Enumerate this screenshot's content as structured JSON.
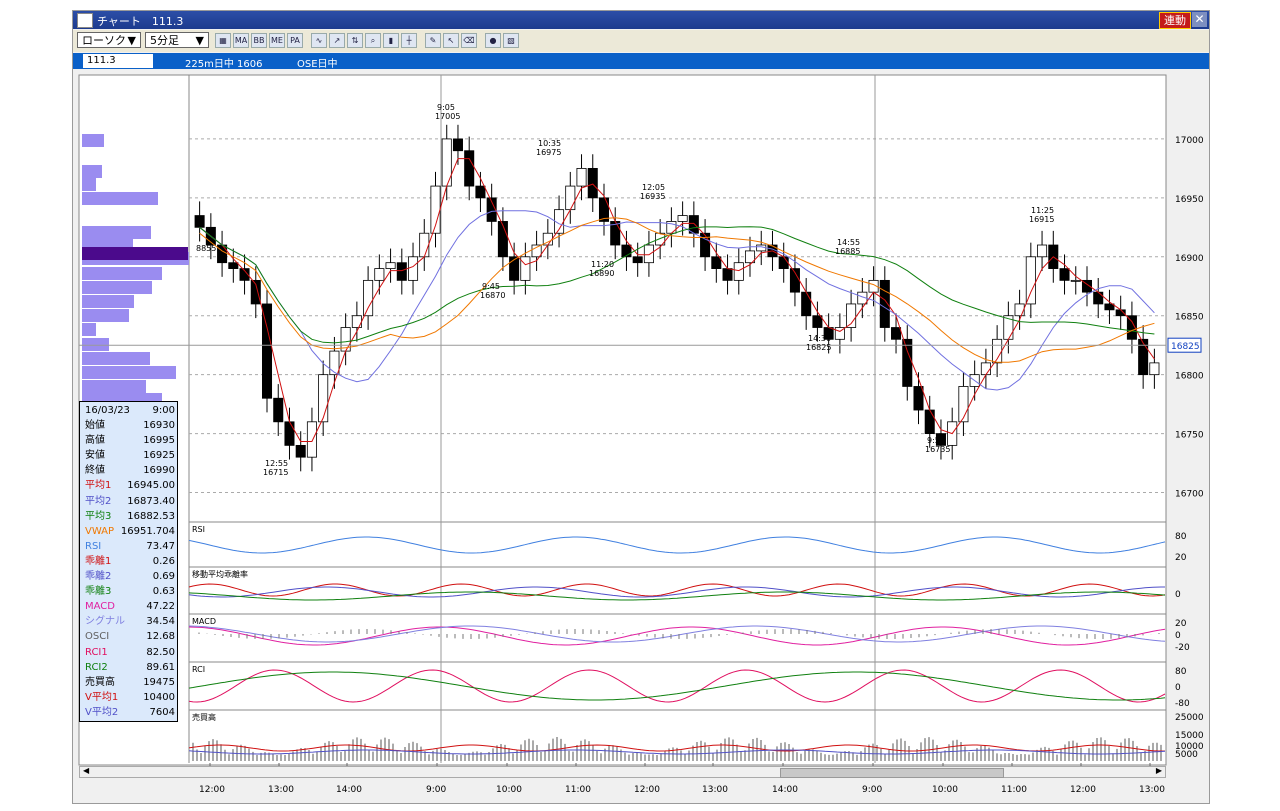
{
  "window": {
    "title": "チャート　111.3",
    "sync_label": "連動",
    "close_label": "✕"
  },
  "toolbar": {
    "chart_type": "ローソク",
    "interval": "5分足",
    "buttons": [
      "map-icon",
      "ma-icon",
      "bb-icon",
      "me-icon",
      "pa-icon",
      "line-icon",
      "trend-icon",
      "scale-icon",
      "zoom-icon",
      "candle-icon",
      "cross-icon",
      "pen-icon",
      "cursor-icon",
      "eraser-icon",
      "bulb-icon",
      "grid-icon"
    ]
  },
  "infobar": {
    "symbol": "111.3",
    "contract": "225m日中 1606",
    "exchange": "OSE日中"
  },
  "price_axis": {
    "ticks": [
      "17000",
      "16950",
      "16900",
      "16850",
      "16800",
      "16750",
      "16700"
    ],
    "current": "16825"
  },
  "annotations": [
    {
      "time": "9:05",
      "price": "17005"
    },
    {
      "time": "10:35",
      "price": "16975"
    },
    {
      "time": "12:05",
      "price": "16935"
    },
    {
      "time": "11:20",
      "price": "16890"
    },
    {
      "time": "9:45",
      "price": "16870"
    },
    {
      "time": "14:55",
      "price": "16885"
    },
    {
      "time": "14:30",
      "price": "16825"
    },
    {
      "time": "12:55",
      "price": "16715"
    },
    {
      "time": "9:55",
      "price": "16735"
    },
    {
      "time": "11:25",
      "price": "16915"
    }
  ],
  "volume_profile_label": "88551",
  "panels": {
    "rsi": {
      "label": "RSI",
      "ticks": [
        "80",
        "20"
      ]
    },
    "deviation": {
      "label": "移動平均乖離率",
      "ticks": [
        "0"
      ]
    },
    "macd": {
      "label": "MACD",
      "ticks": [
        "20",
        "0",
        "-20"
      ]
    },
    "rci": {
      "label": "RCI",
      "ticks": [
        "80",
        "0",
        "-80"
      ]
    },
    "volume": {
      "label": "売買高",
      "ticks": [
        "25000",
        "15000",
        "10000",
        "5000"
      ]
    }
  },
  "time_axis": [
    "12:00",
    "13:00",
    "14:00",
    "9:00",
    "10:00",
    "11:00",
    "12:00",
    "13:00",
    "14:00",
    "9:00",
    "10:00",
    "11:00",
    "12:00",
    "13:00"
  ],
  "info": {
    "date": "16/03/23",
    "time": "9:00",
    "rows": [
      {
        "k": "始値",
        "v": "16930",
        "c": "#000000"
      },
      {
        "k": "高値",
        "v": "16995",
        "c": "#000000"
      },
      {
        "k": "安値",
        "v": "16925",
        "c": "#000000"
      },
      {
        "k": "終値",
        "v": "16990",
        "c": "#000000"
      },
      {
        "k": "平均1",
        "v": "16945.00",
        "c": "#d01010"
      },
      {
        "k": "平均2",
        "v": "16873.40",
        "c": "#5050c8"
      },
      {
        "k": "平均3",
        "v": "16882.53",
        "c": "#108010"
      },
      {
        "k": "VWAP",
        "v": "16951.704",
        "c": "#f07800"
      },
      {
        "k": "RSI",
        "v": "73.47",
        "c": "#4080e0"
      },
      {
        "k": "乖離1",
        "v": "0.26",
        "c": "#d01010"
      },
      {
        "k": "乖離2",
        "v": "0.69",
        "c": "#5050c8"
      },
      {
        "k": "乖離3",
        "v": "0.63",
        "c": "#108010"
      },
      {
        "k": "MACD",
        "v": "47.22",
        "c": "#e020a0"
      },
      {
        "k": "シグナル",
        "v": "34.54",
        "c": "#8080e0"
      },
      {
        "k": "OSCI",
        "v": "12.68",
        "c": "#606060"
      },
      {
        "k": "RCI1",
        "v": "82.50",
        "c": "#e01060"
      },
      {
        "k": "RCI2",
        "v": "89.61",
        "c": "#108010"
      },
      {
        "k": "売買高",
        "v": "19475",
        "c": "#000000"
      },
      {
        "k": "V平均1",
        "v": "10400",
        "c": "#d01010"
      },
      {
        "k": "V平均2",
        "v": "7604",
        "c": "#5050c8"
      }
    ]
  },
  "colors": {
    "titlebar": "#1c3a8e",
    "infobar": "#0a60c8",
    "ma1": "#d01010",
    "ma2": "#7070e0",
    "ma3": "#108010",
    "vwap": "#f07800",
    "profile": "#9a8cf0",
    "profile_hi": "#4b0a8c"
  },
  "chart_data": {
    "type": "candlestick",
    "price_range": [
      16675,
      17050
    ],
    "close_series": [
      16925,
      16910,
      16895,
      16890,
      16880,
      16860,
      16780,
      16760,
      16740,
      16730,
      16760,
      16800,
      16820,
      16840,
      16850,
      16880,
      16890,
      16895,
      16880,
      16900,
      16920,
      16960,
      17000,
      16990,
      16960,
      16950,
      16930,
      16900,
      16880,
      16900,
      16910,
      16920,
      16940,
      16960,
      16975,
      16950,
      16930,
      16910,
      16900,
      16895,
      16910,
      16920,
      16930,
      16935,
      16920,
      16900,
      16890,
      16880,
      16895,
      16905,
      16910,
      16900,
      16890,
      16870,
      16850,
      16840,
      16830,
      16840,
      16860,
      16870,
      16880,
      16840,
      16830,
      16790,
      16770,
      16750,
      16740,
      16760,
      16790,
      16800,
      16810,
      16830,
      16850,
      16860,
      16900,
      16910,
      16890,
      16880,
      16880,
      16870,
      16860,
      16855,
      16850,
      16830,
      16800,
      16810
    ]
  }
}
